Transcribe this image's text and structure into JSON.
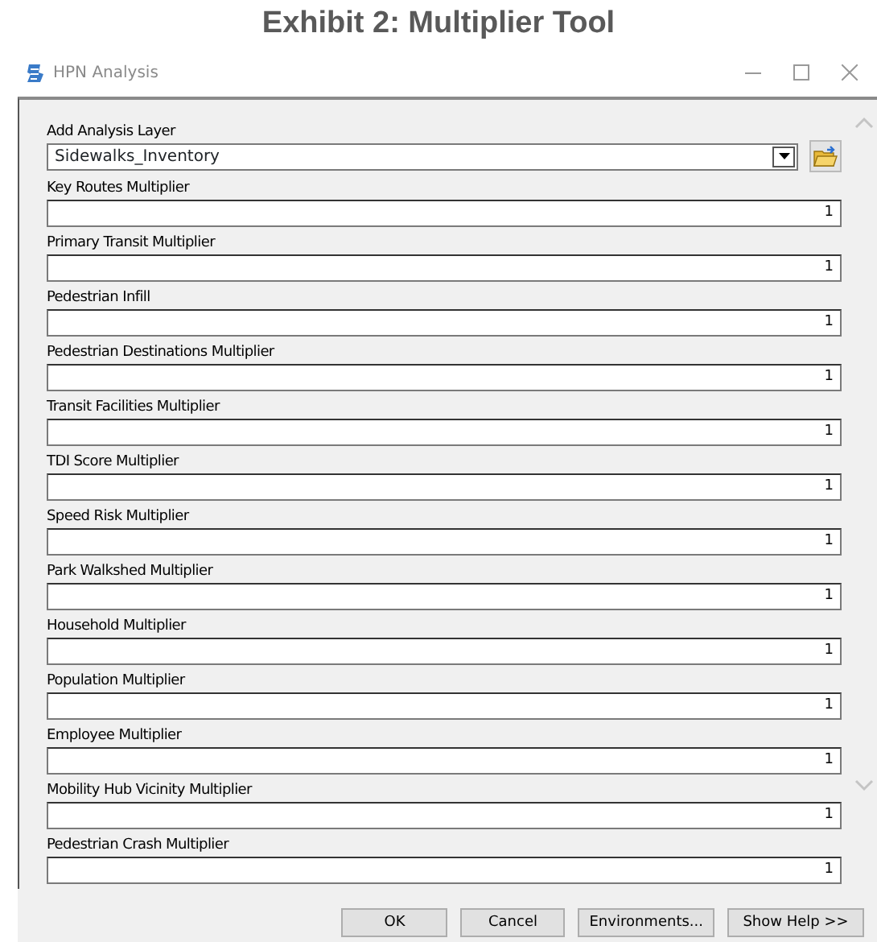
{
  "caption": "Exhibit 2: Multiplier Tool",
  "window": {
    "title": "HPN Analysis"
  },
  "layer": {
    "label": "Add Analysis Layer",
    "value": "Sidewalks_Inventory"
  },
  "fields": [
    {
      "label": "Key Routes Multiplier",
      "value": "1"
    },
    {
      "label": "Primary Transit Multiplier",
      "value": "1"
    },
    {
      "label": "Pedestrian Infill",
      "value": "1"
    },
    {
      "label": "Pedestrian Destinations Multiplier",
      "value": "1"
    },
    {
      "label": "Transit Facilities Multiplier",
      "value": "1"
    },
    {
      "label": "TDI Score Multiplier",
      "value": "1"
    },
    {
      "label": "Speed Risk Multiplier",
      "value": "1"
    },
    {
      "label": "Park Walkshed Multiplier",
      "value": "1"
    },
    {
      "label": "Household Multiplier",
      "value": "1"
    },
    {
      "label": "Population Multiplier",
      "value": "1"
    },
    {
      "label": "Employee Multiplier",
      "value": "1"
    },
    {
      "label": "Mobility Hub Vicinity Multiplier",
      "value": "1"
    },
    {
      "label": "Pedestrian Crash Multiplier",
      "value": "1"
    }
  ],
  "buttons": [
    "OK",
    "Cancel",
    "Environments...",
    "Show Help >>"
  ]
}
